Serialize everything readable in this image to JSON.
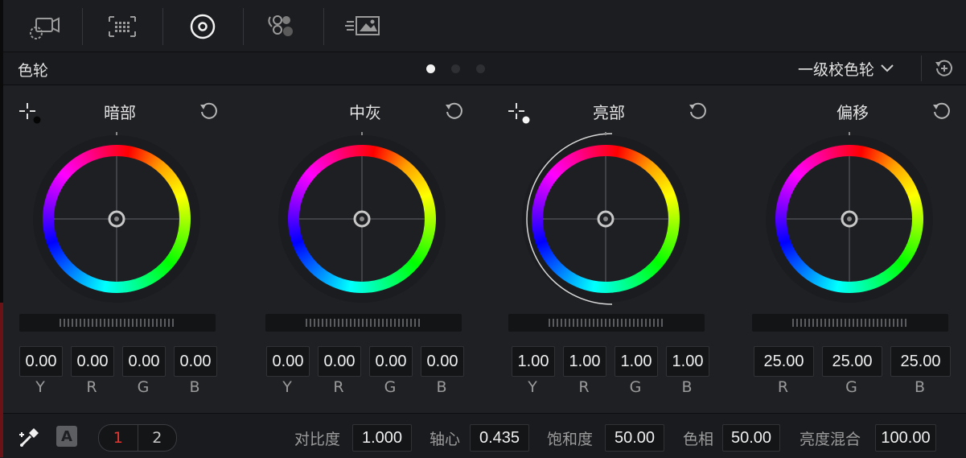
{
  "toolbar": {
    "icons": [
      "camera-raw-icon",
      "color-match-icon",
      "color-wheels-icon",
      "rgb-mixer-icon",
      "motion-effects-icon"
    ],
    "active_index": 2
  },
  "header": {
    "title": "色轮",
    "page_dots": 3,
    "active_dot": 0,
    "mode": "一级校色轮"
  },
  "wheels": [
    {
      "title": "暗部",
      "values": [
        "0.00",
        "0.00",
        "0.00",
        "0.00"
      ],
      "labels": [
        "Y",
        "R",
        "G",
        "B"
      ]
    },
    {
      "title": "中灰",
      "values": [
        "0.00",
        "0.00",
        "0.00",
        "0.00"
      ],
      "labels": [
        "Y",
        "R",
        "G",
        "B"
      ]
    },
    {
      "title": "亮部",
      "values": [
        "1.00",
        "1.00",
        "1.00",
        "1.00"
      ],
      "labels": [
        "Y",
        "R",
        "G",
        "B"
      ]
    },
    {
      "title": "偏移",
      "values": [
        "25.00",
        "25.00",
        "25.00"
      ],
      "labels": [
        "R",
        "G",
        "B"
      ]
    }
  ],
  "bottom": {
    "auto_label": "A",
    "pages": [
      "1",
      "2"
    ],
    "active_page": "1",
    "contrast_label": "对比度",
    "contrast": "1.000",
    "pivot_label": "轴心",
    "pivot": "0.435",
    "saturation_label": "饱和度",
    "saturation": "50.00",
    "hue_label": "色相",
    "hue": "50.00",
    "lum_mix_label": "亮度混合",
    "lum_mix": "100.00"
  },
  "colors": {
    "background": "#1e1f22",
    "accent_red": "#e8352f",
    "value_text": "#f0f0f0"
  }
}
